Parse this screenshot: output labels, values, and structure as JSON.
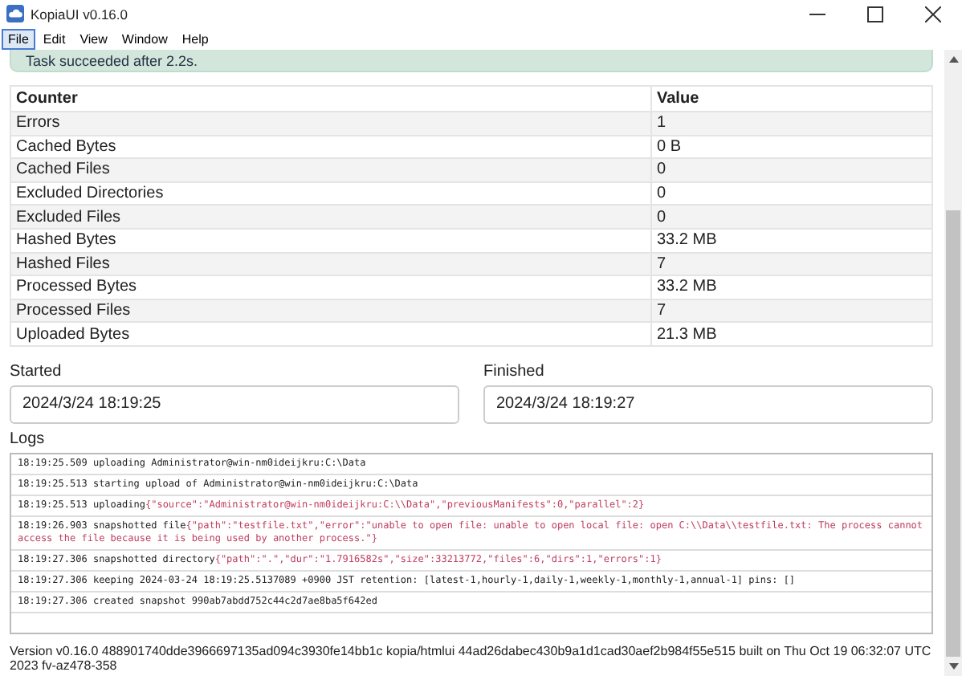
{
  "window": {
    "title": "KopiaUI v0.16.0"
  },
  "menu": [
    {
      "label": "File",
      "selected": true
    },
    {
      "label": "Edit",
      "selected": false
    },
    {
      "label": "View",
      "selected": false
    },
    {
      "label": "Window",
      "selected": false
    },
    {
      "label": "Help",
      "selected": false
    }
  ],
  "banner": {
    "text": "Task succeeded after 2.2s."
  },
  "table": {
    "columns": [
      "Counter",
      "Value"
    ],
    "rows": [
      [
        "Errors",
        "1"
      ],
      [
        "Cached Bytes",
        "0 B"
      ],
      [
        "Cached Files",
        "0"
      ],
      [
        "Excluded Directories",
        "0"
      ],
      [
        "Excluded Files",
        "0"
      ],
      [
        "Hashed Bytes",
        "33.2 MB"
      ],
      [
        "Hashed Files",
        "7"
      ],
      [
        "Processed Bytes",
        "33.2 MB"
      ],
      [
        "Processed Files",
        "7"
      ],
      [
        "Uploaded Bytes",
        "21.3 MB"
      ]
    ]
  },
  "started": {
    "label": "Started",
    "value": "2024/3/24 18:19:25"
  },
  "finished": {
    "label": "Finished",
    "value": "2024/3/24 18:19:27"
  },
  "logs": {
    "label": "Logs",
    "entries": [
      {
        "time": "18:19:25.509",
        "message": "uploading Administrator@win-nm0ideijkru:C:\\Data"
      },
      {
        "time": "18:19:25.513",
        "message": "starting upload of Administrator@win-nm0ideijkru:C:\\Data"
      },
      {
        "time": "18:19:25.513",
        "message": "uploading",
        "details": "{\"source\":\"Administrator@win-nm0ideijkru:C:\\\\Data\",\"previousManifests\":0,\"parallel\":2}"
      },
      {
        "time": "18:19:26.903",
        "message": "snapshotted file",
        "details": "{\"path\":\"testfile.txt\",\"error\":\"unable to open file: unable to open local file: open C:\\\\Data\\\\testfile.txt: The process cannot access the file because it is being used by another process.\"}"
      },
      {
        "time": "18:19:27.306",
        "message": "snapshotted directory",
        "details": "{\"path\":\".\",\"dur\":\"1.7916582s\",\"size\":33213772,\"files\":6,\"dirs\":1,\"errors\":1}"
      },
      {
        "time": "18:19:27.306",
        "message": "keeping 2024-03-24 18:19:25.5137089 +0900 JST retention: [latest-1,hourly-1,daily-1,weekly-1,monthly-1,annual-1] pins: []"
      },
      {
        "time": "18:19:27.306",
        "message": "created snapshot 990ab7abdd752c44c2d7ae8ba5f642ed"
      }
    ]
  },
  "footer": {
    "text": "Version v0.16.0 488901740dde3966697135ad094c3930fe14bb1c kopia/htmlui 44ad26dabec430b9a1d1cad30aef2b984f55e515 built on Thu Oct 19 06:32:07 UTC 2023 fv-az478-358"
  }
}
